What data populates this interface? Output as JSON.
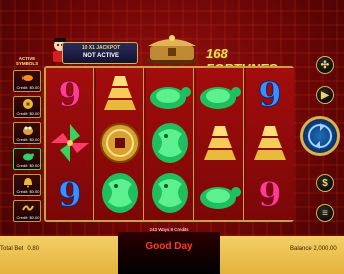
{
  "header": {
    "title": "168 FORTUNES",
    "jackpot_title": "10 X1 JACKPOT",
    "jackpot_status": "NOT ACTIVE"
  },
  "left_panel": {
    "heading": "ACTIVE SYMBOLS",
    "cards": [
      {
        "icon": "fish-icon",
        "credit": "Credit: $0.00"
      },
      {
        "icon": "coin-icon",
        "credit": "Credit: $0.00"
      },
      {
        "icon": "frog-icon",
        "credit": "Credit: $0.00"
      },
      {
        "icon": "turtle-icon",
        "credit": "Credit: $0.00"
      },
      {
        "icon": "bell-icon",
        "credit": "Credit: $0.00"
      },
      {
        "icon": "dragon-icon",
        "credit": "Credit: $0.00"
      }
    ]
  },
  "reels": [
    [
      "number-9-symbol",
      "pinwheel-symbol",
      "number-9-symbol"
    ],
    [
      "gold-ingots-symbol",
      "gold-coin-symbol",
      "jade-dragon-symbol"
    ],
    [
      "jade-turtle-symbol",
      "jade-dragon-symbol",
      "jade-dragon-symbol"
    ],
    [
      "jade-turtle-symbol",
      "gold-ingots-symbol",
      "jade-turtle-symbol"
    ],
    [
      "number-9-symbol",
      "gold-ingots-symbol",
      "number-9-symbol"
    ]
  ],
  "controls": [
    "settings-icon",
    "autoplay-icon",
    "spin-button",
    "dollar-icon",
    "menu-icon"
  ],
  "footer": {
    "total_bet_label": "Total Bet",
    "total_bet_value": "0.80",
    "ways_text": "243 Ways  8 Credits",
    "message": "Good Day",
    "balance_label": "Balance",
    "balance_value": "2,000.00"
  },
  "colors": {
    "gold": "#d8b24a",
    "jade": "#2fcf6a",
    "red_bg": "#9c1212",
    "message_red": "#ff3b1f"
  }
}
